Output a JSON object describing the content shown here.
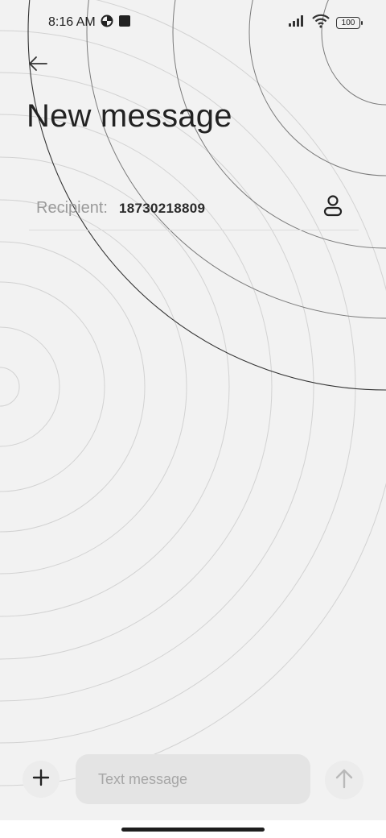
{
  "status_bar": {
    "time": "8:16 AM",
    "battery_level": "100",
    "icons": [
      "data-saver-icon",
      "square-notification-icon",
      "signal-icon",
      "wifi-icon",
      "battery-icon"
    ]
  },
  "header": {
    "title": "New message",
    "back_icon": "back-arrow-icon"
  },
  "recipient": {
    "label": "Recipient:",
    "value": "18730218809",
    "contact_icon": "person-icon"
  },
  "composer": {
    "placeholder": "Text message",
    "attach_icon": "plus-icon",
    "send_icon": "send-arrow-icon"
  },
  "colors": {
    "background": "#f2f2f2",
    "text_primary": "#222222",
    "text_secondary": "#9a9a9a",
    "input_background": "#e4e4e4"
  }
}
